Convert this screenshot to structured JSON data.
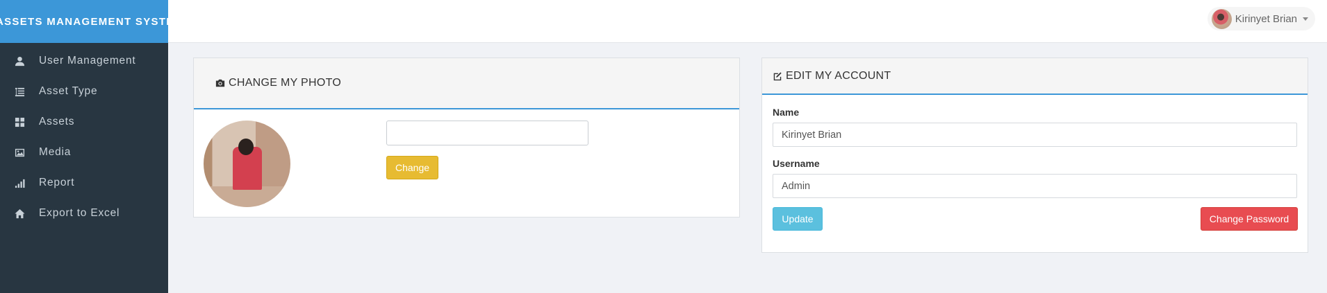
{
  "app": {
    "title": "ASSETS MANAGEMENT SYSTEM"
  },
  "sidebar": {
    "items": [
      {
        "label": "User Management",
        "icon": "user-icon"
      },
      {
        "label": "Asset Type",
        "icon": "list-indent-icon"
      },
      {
        "label": "Assets",
        "icon": "grid-icon"
      },
      {
        "label": "Media",
        "icon": "image-icon"
      },
      {
        "label": "Report",
        "icon": "bar-signal-icon"
      },
      {
        "label": "Export to Excel",
        "icon": "home-icon"
      }
    ]
  },
  "header": {
    "user_name": "Kirinyet Brian"
  },
  "photo_panel": {
    "title": "CHANGE MY PHOTO",
    "change_label": "Change"
  },
  "account_panel": {
    "title": "EDIT MY ACCOUNT",
    "name_label": "Name",
    "name_value": "Kirinyet Brian",
    "username_label": "Username",
    "username_value": "Admin",
    "update_label": "Update",
    "change_password_label": "Change Password"
  },
  "colors": {
    "brand": "#3c97d8",
    "sidebar": "#283641",
    "warning": "#e7bb32",
    "info": "#5bc0de",
    "danger": "#e84c51"
  }
}
